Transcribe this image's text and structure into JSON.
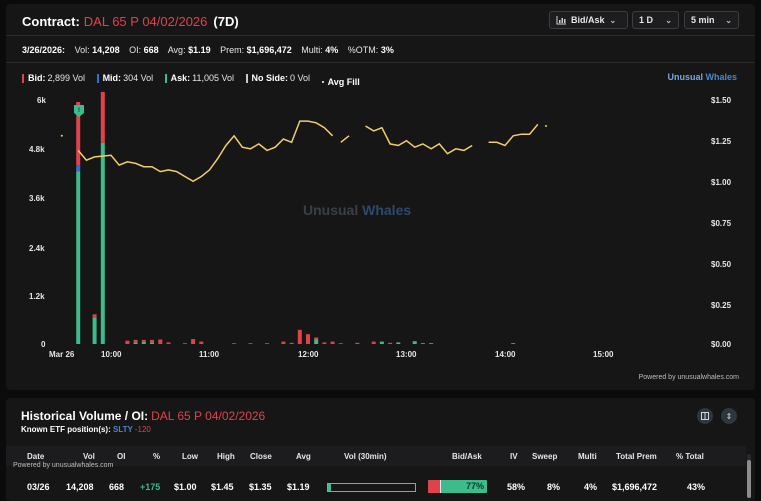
{
  "header": {
    "contract_label": "Contract:",
    "contract_name": "DAL 65 P 04/02/2026",
    "period": "(7D)",
    "controls": [
      {
        "label": "Bid/Ask",
        "icon": "bar-chart-icon"
      },
      {
        "label": "1 D"
      },
      {
        "label": "5 min"
      }
    ]
  },
  "stats": {
    "date": "3/26/2026:",
    "vol_label": "Vol:",
    "vol": "14,208",
    "oi_label": "OI:",
    "oi": "668",
    "avg_label": "Avg:",
    "avg": "$1.19",
    "prem_label": "Prem:",
    "prem": "$1,696,472",
    "multi_label": "Multi:",
    "multi": "4%",
    "otm_label": "%OTM:",
    "otm": "3%"
  },
  "legend": {
    "bid_label": "Bid:",
    "bid": "2,899 Vol",
    "mid_label": "Mid:",
    "mid": "304 Vol",
    "ask_label": "Ask:",
    "ask": "11,005 Vol",
    "noside_label": "No Side:",
    "noside": "0 Vol",
    "avgfill_label": "Avg Fill"
  },
  "brand": {
    "part1": "Unusual",
    "part2": "Whales"
  },
  "colors": {
    "bid": "#e0424b",
    "mid": "#2f6fd6",
    "ask": "#3dbb8b",
    "nos": "#c9c9c9",
    "avg": "#f2cd6b"
  },
  "chart_data": {
    "type": "bar+line",
    "watermark_1": "Unusual",
    "watermark_2": "Whales",
    "left_ticks": [
      "6k",
      "4.8k",
      "3.6k",
      "2.4k",
      "1.2k",
      "0"
    ],
    "right_ticks": [
      "$1.50",
      "$1.25",
      "$1.00",
      "$0.75",
      "$0.50",
      "$0.25",
      "$0.00"
    ],
    "x_ticks": [
      "Mar 26",
      "10:00",
      "11:00",
      "12:00",
      "13:00",
      "14:00",
      "15:00"
    ],
    "ylim_volume": [
      0,
      6000
    ],
    "ylim_price": [
      0,
      1.5
    ],
    "marker_label": "!",
    "bars": [
      {
        "t": "09:40",
        "bid": 1550,
        "mid": 150,
        "ask": 4250
      },
      {
        "t": "09:50",
        "bid": 80,
        "mid": 0,
        "ask": 650
      },
      {
        "t": "09:55",
        "bid": 1250,
        "mid": 0,
        "ask": 4950
      },
      {
        "t": "10:10",
        "bid": 80,
        "mid": 0,
        "ask": 0
      },
      {
        "t": "10:15",
        "bid": 60,
        "mid": 0,
        "ask": 40
      },
      {
        "t": "10:20",
        "bid": 50,
        "mid": 0,
        "ask": 50
      },
      {
        "t": "10:25",
        "bid": 60,
        "mid": 0,
        "ask": 40
      },
      {
        "t": "10:30",
        "bid": 110,
        "mid": 0,
        "ask": 0
      },
      {
        "t": "10:35",
        "bid": 40,
        "mid": 0,
        "ask": 0
      },
      {
        "t": "10:45",
        "bid": 20,
        "mid": 0,
        "ask": 0
      },
      {
        "t": "10:50",
        "bid": 120,
        "mid": 0,
        "ask": 0
      },
      {
        "t": "10:55",
        "bid": 60,
        "mid": 0,
        "ask": 0
      },
      {
        "t": "11:15",
        "bid": 20,
        "mid": 0,
        "ask": 0
      },
      {
        "t": "11:25",
        "bid": 20,
        "mid": 0,
        "ask": 0
      },
      {
        "t": "11:35",
        "bid": 20,
        "mid": 0,
        "ask": 0
      },
      {
        "t": "11:45",
        "bid": 60,
        "mid": 0,
        "ask": 0
      },
      {
        "t": "11:50",
        "bid": 30,
        "mid": 0,
        "ask": 0
      },
      {
        "t": "11:55",
        "bid": 350,
        "mid": 0,
        "ask": 0
      },
      {
        "t": "12:00",
        "bid": 240,
        "mid": 0,
        "ask": 0
      },
      {
        "t": "12:05",
        "bid": 40,
        "mid": 0,
        "ask": 120
      },
      {
        "t": "12:10",
        "bid": 40,
        "mid": 0,
        "ask": 0
      },
      {
        "t": "12:15",
        "bid": 60,
        "mid": 0,
        "ask": 0
      },
      {
        "t": "12:20",
        "bid": 20,
        "mid": 0,
        "ask": 0
      },
      {
        "t": "12:30",
        "bid": 30,
        "mid": 0,
        "ask": 0
      },
      {
        "t": "12:40",
        "bid": 60,
        "mid": 0,
        "ask": 0
      },
      {
        "t": "12:45",
        "bid": 0,
        "mid": 0,
        "ask": 60
      },
      {
        "t": "12:50",
        "bid": 30,
        "mid": 0,
        "ask": 0
      },
      {
        "t": "12:55",
        "bid": 0,
        "mid": 0,
        "ask": 40
      },
      {
        "t": "13:05",
        "bid": 0,
        "mid": 0,
        "ask": 70
      },
      {
        "t": "13:10",
        "bid": 0,
        "mid": 0,
        "ask": 20
      },
      {
        "t": "13:15",
        "bid": 0,
        "mid": 0,
        "ask": 20
      },
      {
        "t": "14:05",
        "bid": 0,
        "mid": 0,
        "ask": 20
      }
    ],
    "price_segments": [
      [
        [
          "09:30",
          1.28
        ]
      ],
      [
        [
          "09:40",
          1.19
        ],
        [
          "09:45",
          1.13
        ],
        [
          "09:50",
          1.15
        ],
        [
          "10:00",
          1.16
        ],
        [
          "10:05",
          1.1
        ],
        [
          "10:10",
          1.12
        ],
        [
          "10:15",
          1.11
        ],
        [
          "10:20",
          1.09
        ],
        [
          "10:25",
          1.09
        ],
        [
          "10:30",
          1.06
        ],
        [
          "10:35",
          1.07
        ],
        [
          "10:40",
          1.06
        ],
        [
          "10:45",
          1.03
        ],
        [
          "10:50",
          1.0
        ],
        [
          "10:55",
          1.03
        ],
        [
          "11:00",
          1.07
        ],
        [
          "11:05",
          1.14
        ],
        [
          "11:10",
          1.22
        ],
        [
          "11:15",
          1.28
        ],
        [
          "11:20",
          1.21
        ],
        [
          "11:25",
          1.2
        ],
        [
          "11:30",
          1.23
        ],
        [
          "11:35",
          1.19
        ],
        [
          "11:40",
          1.21
        ],
        [
          "11:45",
          1.26
        ],
        [
          "11:50",
          1.24
        ],
        [
          "11:55",
          1.37
        ],
        [
          "12:00",
          1.37
        ],
        [
          "12:05",
          1.36
        ],
        [
          "12:10",
          1.33
        ],
        [
          "12:15",
          1.28
        ]
      ],
      [
        [
          "12:20",
          1.24
        ],
        [
          "12:25",
          1.28
        ]
      ],
      [
        [
          "12:35",
          1.34
        ],
        [
          "12:40",
          1.31
        ],
        [
          "12:45",
          1.33
        ],
        [
          "12:50",
          1.23
        ],
        [
          "12:55",
          1.22
        ],
        [
          "13:00",
          1.25
        ],
        [
          "13:05",
          1.21
        ],
        [
          "13:10",
          1.23
        ],
        [
          "13:15",
          1.2
        ],
        [
          "13:20",
          1.23
        ],
        [
          "13:25",
          1.17
        ],
        [
          "13:30",
          1.2
        ],
        [
          "13:35",
          1.19
        ],
        [
          "13:40",
          1.22
        ]
      ],
      [
        [
          "13:50",
          1.24
        ],
        [
          "13:55",
          1.24
        ],
        [
          "14:00",
          1.22
        ],
        [
          "14:05",
          1.28
        ],
        [
          "14:10",
          1.29
        ],
        [
          "14:15",
          1.29
        ],
        [
          "14:20",
          1.35
        ]
      ],
      [
        [
          "14:25",
          1.34
        ]
      ]
    ]
  },
  "powered_by": "Powered by unusualwhales.com",
  "historical": {
    "title": "Historical Volume / OI:",
    "contract": "DAL 65 P 04/02/2026",
    "etf_label": "Known ETF position(s):",
    "etf_ticker": "SLTY",
    "etf_value": "-120",
    "powered": "Powered by unusualwhales.com",
    "columns": [
      "Date",
      "Vol",
      "OI",
      "%",
      "Low",
      "High",
      "Close",
      "Avg",
      "Vol (30min)",
      "Bid/Ask",
      "IV",
      "Sweep",
      "Multi",
      "Total Prem",
      "% Total"
    ],
    "row": {
      "date": "03/26",
      "vol": "14,208",
      "oi": "668",
      "change": "+175",
      "low": "$1.00",
      "high": "$1.45",
      "close": "$1.35",
      "avg": "$1.19",
      "vol30_fraction": 0.04,
      "bid_fraction": 0.2,
      "mid_fraction": 0.02,
      "ask_pct": "77%",
      "iv": "58%",
      "sweep": "8%",
      "multi": "4%",
      "total_prem": "$1,696,472",
      "pct_total": "43%"
    }
  }
}
